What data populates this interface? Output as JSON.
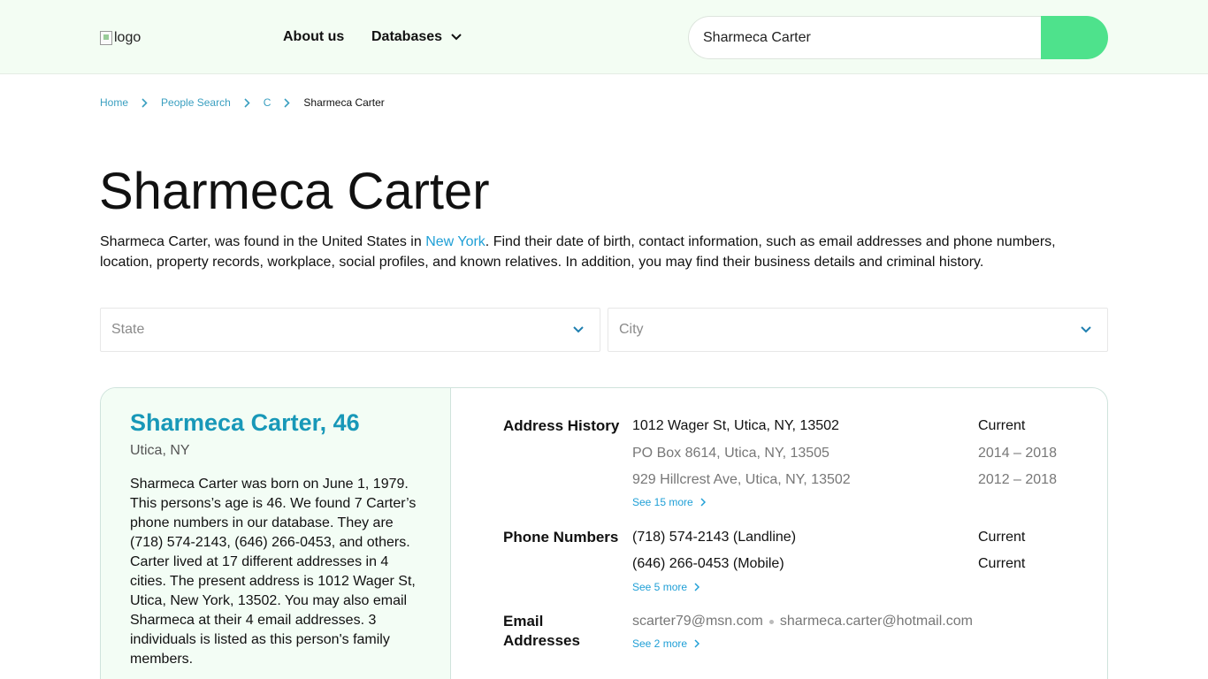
{
  "header": {
    "logo_alt": "logo",
    "nav": {
      "about": "About us",
      "databases": "Databases"
    },
    "search_value": "Sharmeca Carter"
  },
  "breadcrumb": [
    "Home",
    "People Search",
    "C",
    "Sharmeca Carter"
  ],
  "page": {
    "title": "Sharmeca Carter",
    "intro_before": "Sharmeca Carter, was found in the United States in ",
    "intro_link": "New York",
    "intro_after": ". Find their date of birth, contact information, such as email addresses and phone numbers, location, property records, workplace, social profiles, and known relatives. In addition, you may find their business details and criminal history."
  },
  "filters": {
    "state_placeholder": "State",
    "city_placeholder": "City"
  },
  "card": {
    "name": "Sharmeca Carter, 46",
    "location": "Utica, NY",
    "bio": "Sharmeca Carter was born on June 1, 1979. This persons’s age is 46. We found 7 Carter’s phone numbers in our database. They are (718) 574-2143, (646) 266-0453, and others. Carter lived at 17 different addresses in 4 cities. The present address is 1012 Wager St, Utica, New York, 13502. You may also email Sharmeca at their 4 email addresses. 3 individuals is listed as this person's family members.",
    "address_history": {
      "label": "Address History",
      "items": [
        {
          "address": "1012 Wager St, Utica, NY, 13502",
          "when": "Current"
        },
        {
          "address": "PO Box 8614, Utica, NY, 13505",
          "when": "2014 – 2018"
        },
        {
          "address": "929 Hillcrest Ave, Utica, NY, 13502",
          "when": "2012 – 2018"
        }
      ],
      "more": "See 15 more"
    },
    "phones": {
      "label": "Phone Numbers",
      "items": [
        {
          "number": "(718) 574-2143 (Landline)",
          "when": "Current"
        },
        {
          "number": "(646) 266-0453 (Mobile)",
          "when": "Current"
        }
      ],
      "more": "See 5 more"
    },
    "emails": {
      "label_line1": "Email",
      "label_line2": "Addresses",
      "items": [
        "scarter79@msn.com",
        "sharmeca.carter@hotmail.com"
      ],
      "more": "See 2 more"
    }
  }
}
